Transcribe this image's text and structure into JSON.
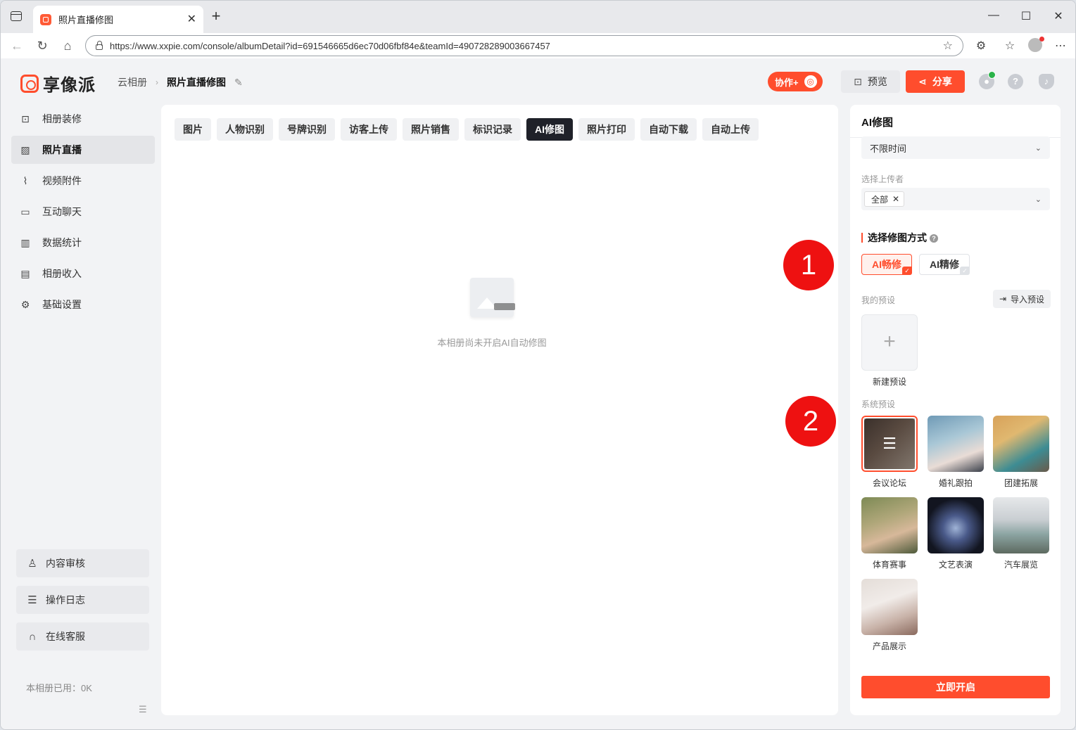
{
  "browser": {
    "tab_title": "照片直播修图",
    "url": "https://www.xxpie.com/console/albumDetail?id=691546665d6ec70d06fbf84e&teamId=490728289003667457",
    "minimize": "—",
    "maximize": "☐",
    "close": "✕"
  },
  "header": {
    "logo_text": "享像派",
    "breadcrumb_root": "云相册",
    "breadcrumb_current": "照片直播修图",
    "collab_label": "协作+",
    "preview_label": "预览",
    "share_label": "分享"
  },
  "sidebar": {
    "items": [
      {
        "label": "相册装修",
        "icon": "scan-icon"
      },
      {
        "label": "照片直播",
        "icon": "image-icon"
      },
      {
        "label": "视频附件",
        "icon": "paperclip-icon"
      },
      {
        "label": "互动聊天",
        "icon": "chat-icon"
      },
      {
        "label": "数据统计",
        "icon": "chart-icon"
      },
      {
        "label": "相册收入",
        "icon": "wallet-icon"
      },
      {
        "label": "基础设置",
        "icon": "gear-icon"
      }
    ],
    "content_review": "内容审核",
    "operation_log": "操作日志",
    "online_service": "在线客服",
    "usage": "本相册已用：0K"
  },
  "main": {
    "tabs": [
      "图片",
      "人物识别",
      "号牌识别",
      "访客上传",
      "照片销售",
      "标识记录",
      "AI修图",
      "照片打印",
      "自动下载",
      "自动上传"
    ],
    "active_tab": "AI修图",
    "empty_text": "本相册尚未开启AI自动修图",
    "badge_1": "1",
    "badge_2": "2"
  },
  "panel": {
    "title": "AI修图",
    "time_select": "不限时间",
    "uploader_label": "选择上传者",
    "uploader_chip": "全部",
    "method_title": "选择修图方式",
    "mode_fast": "AI畅修",
    "mode_fine": "AI精修",
    "my_presets_label": "我的预设",
    "import_label": "导入预设",
    "new_preset_label": "新建预设",
    "system_presets_label": "系统预设",
    "presets": [
      "会议论坛",
      "婚礼跟拍",
      "团建拓展",
      "体育赛事",
      "文艺表演",
      "汽车展览",
      "产品展示"
    ],
    "start_button": "立即开启"
  },
  "colors": {
    "accent": "#ff4d2d",
    "active_tab": "#1f2129",
    "badge": "#ee1111"
  }
}
